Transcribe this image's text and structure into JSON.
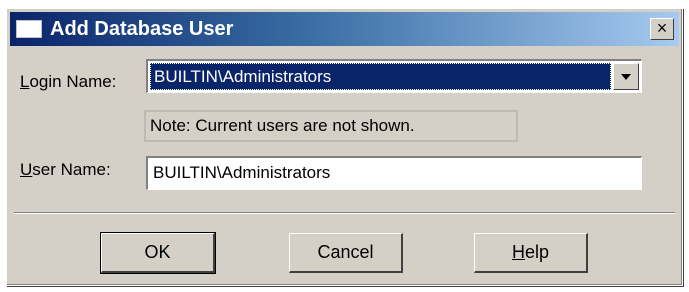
{
  "window": {
    "title": "Add Database User",
    "close_glyph": "×"
  },
  "login": {
    "label_mnemonic": "L",
    "label_rest": "ogin Name:",
    "value": "BUILTIN\\Administrators",
    "dropdown_icon": "chevron-down-icon"
  },
  "note": {
    "text": "Note: Current users are not shown."
  },
  "user": {
    "label_mnemonic": "U",
    "label_rest": "ser Name:",
    "value": "BUILTIN\\Administrators"
  },
  "buttons": {
    "ok": "OK",
    "cancel": "Cancel",
    "help_mnemonic": "H",
    "help_rest": "elp"
  }
}
